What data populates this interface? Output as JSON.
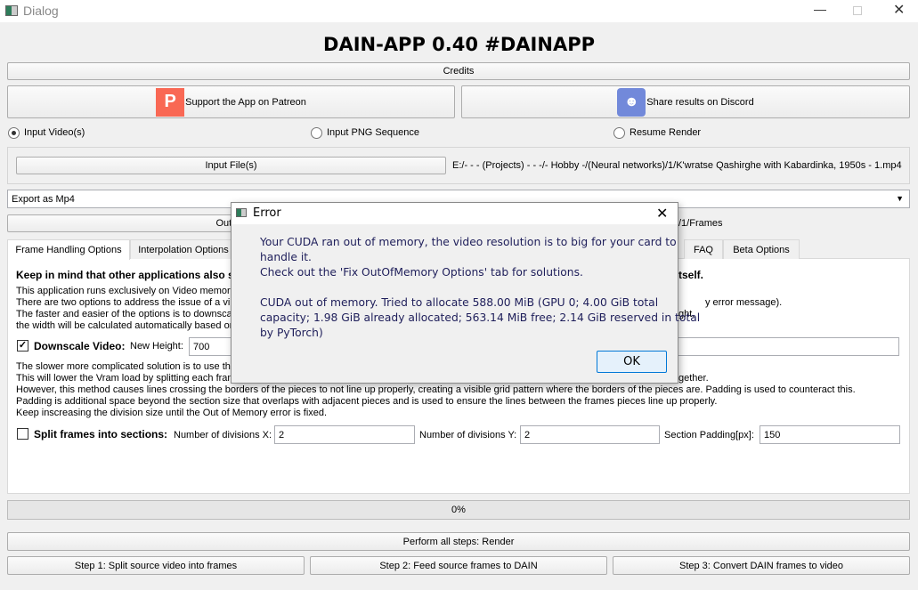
{
  "window": {
    "title": "Dialog"
  },
  "heading": "DAIN-APP 0.40 #DAINAPP",
  "buttons": {
    "credits": "Credits",
    "patreon": "Support the App on Patreon",
    "discord": "Share results on Discord",
    "input_file": "Input File(s)",
    "output": "Output",
    "render_all": "Perform all steps: Render",
    "step1": "Step 1: Split source video into frames",
    "step2": "Step 2: Feed source frames to DAIN",
    "step3": "Step 3: Convert DAIN frames to video"
  },
  "radios": [
    {
      "label": "Input Video(s)",
      "checked": true
    },
    {
      "label": "Input PNG Sequence",
      "checked": false
    },
    {
      "label": "Resume Render",
      "checked": false
    }
  ],
  "input_path": "E:/- - - (Projects) - - -/- Hobby -/(Neural networks)/1/K'wratse Qashirghe with Kabardinka, 1950s - 1.mp4",
  "output_path_visible": "/1/Frames",
  "export_combo": "Export as Mp4",
  "tabs": [
    "Frame Handling Options",
    "Interpolation Options",
    "FAQ",
    "Beta Options"
  ],
  "panel": {
    "warning_left": "Keep in mind that other applications also s",
    "warning_right": "tself.",
    "lines_left": [
      "This application runs exclusively on Video memory ",
      "There are two options to address the issue of a vi",
      "The faster and easier of the options is to downsca",
      "the width will be calculated automatically based on"
    ],
    "lines_right": [
      "",
      "y error message).",
      "ght,",
      ""
    ],
    "downscale_label": "Downscale Video:",
    "downscale_checked": true,
    "new_height_label": "New Height:",
    "new_height_value": "700",
    "split_lines_left": [
      "The slower more complicated solution is to use the",
      "This will lower the Vram load by splitting each fram"
    ],
    "split_lines_right": [
      "",
      "gether."
    ],
    "split_lines_full": [
      "However, this method causes lines crossing the borders of the pieces to not line up properly, creating  a visible grid pattern where the borders of the pieces are. Padding is used to counteract this.",
      "Padding is additional space beyond the section size that overlaps with adjacent pieces and is used to ensure the lines between the frames pieces line up properly.",
      "Keep inscreasing the division size until the Out of Memory error is fixed."
    ],
    "split_label": "Split frames into sections:",
    "split_checked": false,
    "div_x_label": "Number of divisions X:",
    "div_x": "2",
    "div_y_label": "Number of divisions Y:",
    "div_y": "2",
    "padding_label": "Section Padding[px]:",
    "padding": "150"
  },
  "progress": {
    "percent": 0,
    "label": "0%"
  },
  "dialog": {
    "title": "Error",
    "lines": [
      "Your CUDA ran out of memory, the video resolution is to big for your card to",
      "handle it.",
      "Check out the 'Fix OutOfMemory Options' tab for solutions.",
      "",
      "CUDA out of memory. Tried to allocate 588.00 MiB (GPU 0; 4.00 GiB total",
      "capacity; 1.98 GiB already allocated; 563.14 MiB free; 2.14 GiB reserved in total",
      "by PyTorch)"
    ],
    "ok": "OK"
  },
  "colors": {
    "patreon": "#f96854",
    "discord": "#7289da"
  }
}
